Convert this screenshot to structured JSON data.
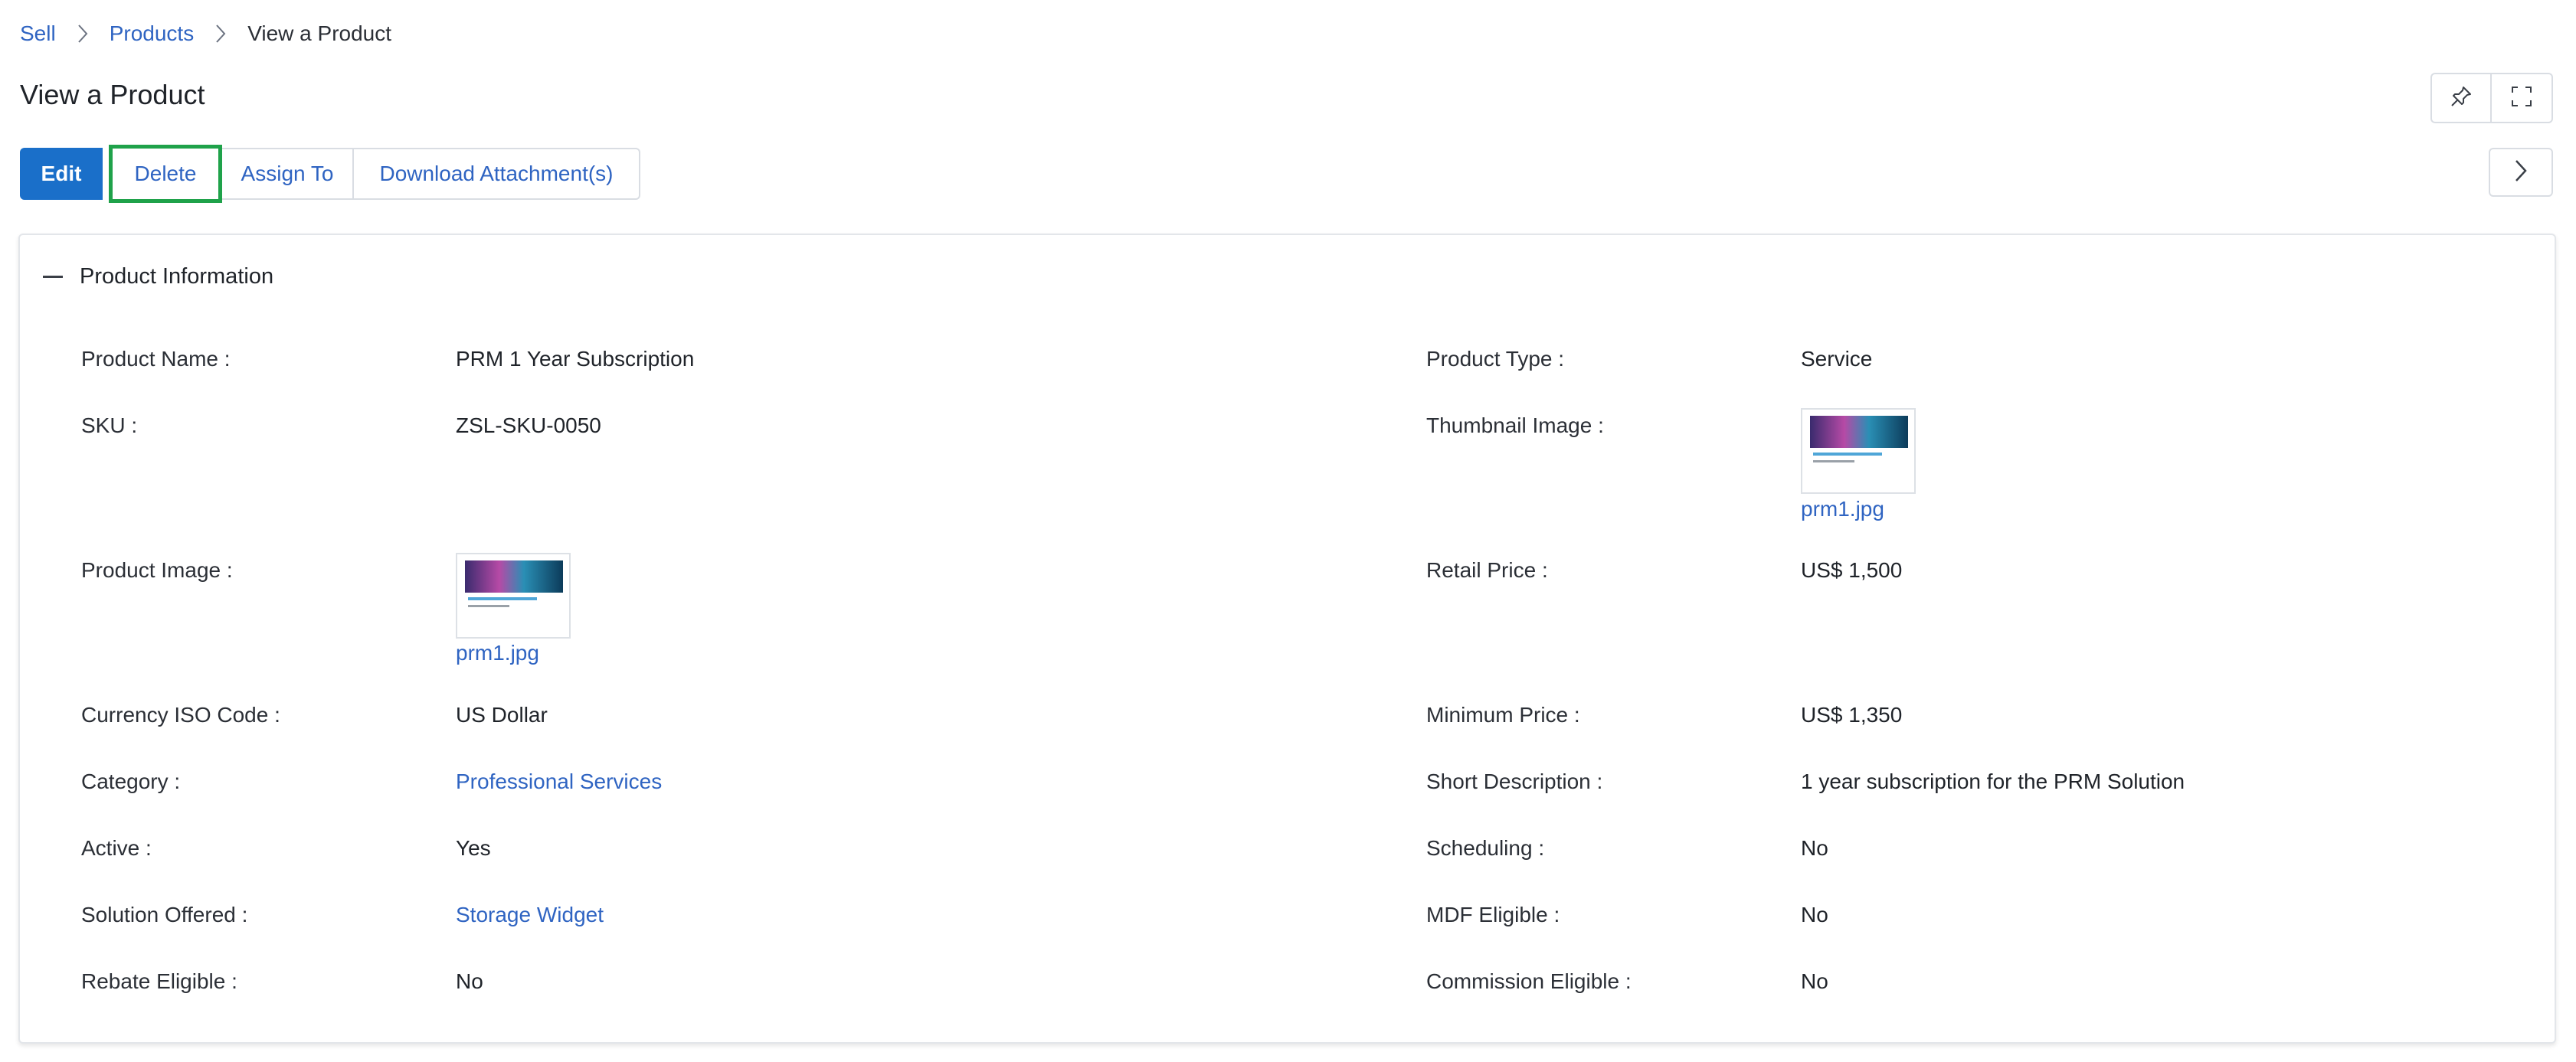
{
  "breadcrumb": {
    "items": [
      "Sell",
      "Products"
    ],
    "current": "View a Product"
  },
  "page": {
    "title": "View a Product"
  },
  "toolbar": {
    "edit": "Edit",
    "delete": "Delete",
    "assign": "Assign To",
    "download": "Download Attachment(s)"
  },
  "panel": {
    "title": "Product Information"
  },
  "fields": {
    "product_name": {
      "label": "Product Name :",
      "value": "PRM 1 Year Subscription"
    },
    "product_type": {
      "label": "Product Type :",
      "value": "Service"
    },
    "sku": {
      "label": "SKU :",
      "value": "ZSL-SKU-0050"
    },
    "thumbnail_image": {
      "label": "Thumbnail Image :",
      "value": "prm1.jpg"
    },
    "product_image": {
      "label": "Product Image :",
      "value": "prm1.jpg"
    },
    "retail_price": {
      "label": "Retail Price :",
      "value": "US$ 1,500"
    },
    "currency": {
      "label": "Currency ISO Code :",
      "value": "US Dollar"
    },
    "minimum_price": {
      "label": "Minimum Price :",
      "value": "US$ 1,350"
    },
    "category": {
      "label": "Category :",
      "value": "Professional Services"
    },
    "short_description": {
      "label": "Short Description :",
      "value": "1 year subscription for the PRM Solution"
    },
    "active": {
      "label": "Active :",
      "value": "Yes"
    },
    "scheduling": {
      "label": "Scheduling :",
      "value": "No"
    },
    "solution_offered": {
      "label": "Solution Offered :",
      "value": "Storage Widget"
    },
    "mdf_eligible": {
      "label": "MDF Eligible :",
      "value": "No"
    },
    "rebate_eligible": {
      "label": "Rebate Eligible :",
      "value": "No"
    },
    "commission_eligible": {
      "label": "Commission Eligible :",
      "value": "No"
    }
  },
  "colors": {
    "primary": "#1a6fc9",
    "link": "#2f64c2",
    "highlight": "#1fa24a"
  },
  "icons": {
    "pin": "pin-icon",
    "expand": "expand-icon",
    "next": "chevron-right-icon",
    "collapse": "minus-icon"
  }
}
